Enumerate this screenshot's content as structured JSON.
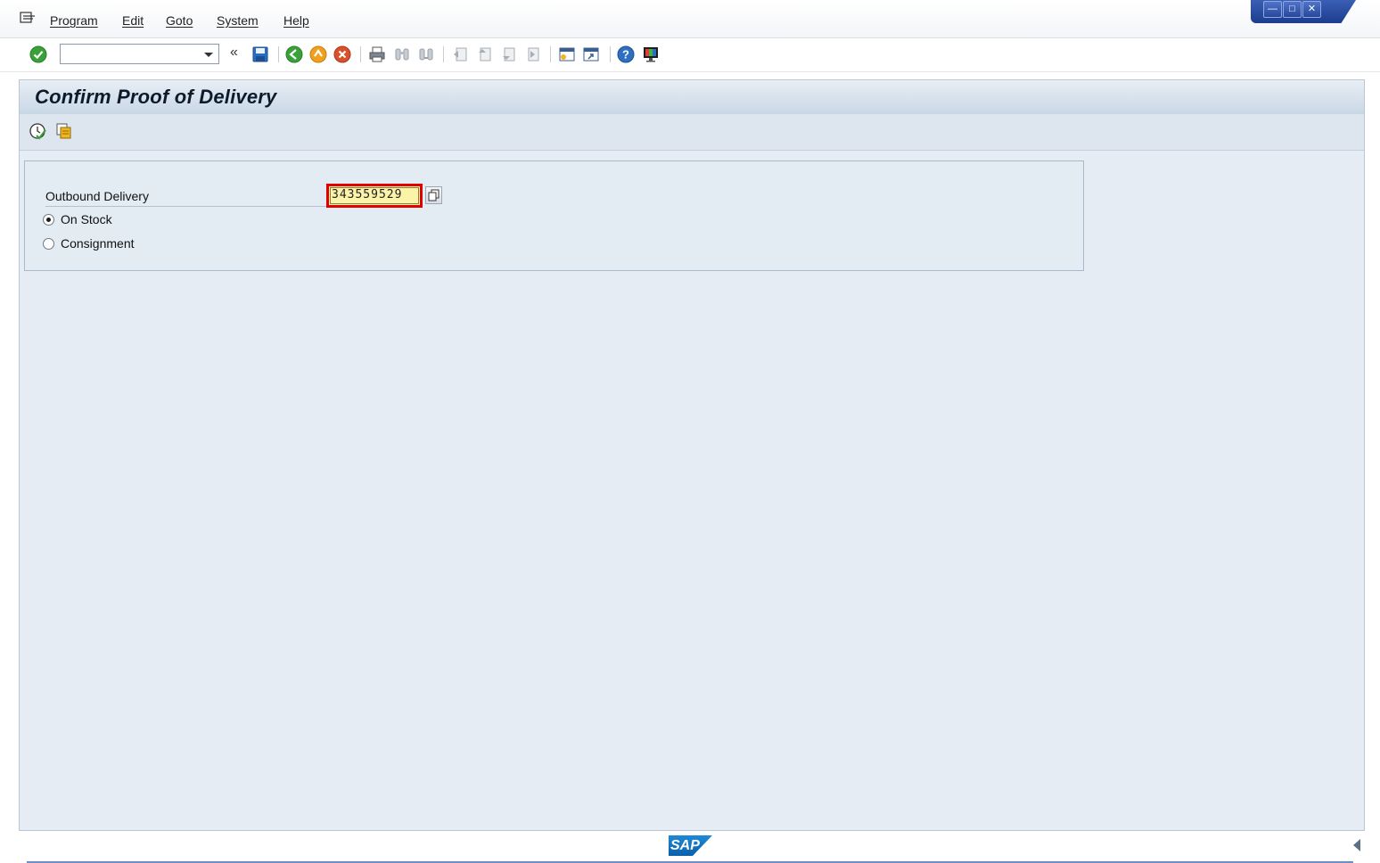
{
  "menubar": {
    "items": [
      "Program",
      "Edit",
      "Goto",
      "System",
      "Help"
    ]
  },
  "toolbar": {
    "command_field_value": "",
    "icons": [
      "enter-icon",
      "back-icon",
      "exit-icon",
      "cancel-icon",
      "save-icon",
      "print-icon",
      "find-icon",
      "find-next-icon",
      "first-page-icon",
      "previous-page-icon",
      "next-page-icon",
      "last-page-icon",
      "new-session-icon",
      "shortcut-icon",
      "help-icon",
      "layout-menu-icon"
    ],
    "colors": {
      "enter": "#3aa13a",
      "back": "#3aa13a",
      "exit": "#f0a020",
      "cancel": "#d9502a",
      "help": "#2f6fc0"
    }
  },
  "page": {
    "title": "Confirm Proof of Delivery"
  },
  "form": {
    "outbound_delivery_label": "Outbound Delivery",
    "outbound_delivery_value": "343559529",
    "radio_on_stock": "On Stock",
    "radio_consignment": "Consignment",
    "selected_option": "On Stock"
  },
  "footer": {
    "logo_text": "SAP"
  }
}
